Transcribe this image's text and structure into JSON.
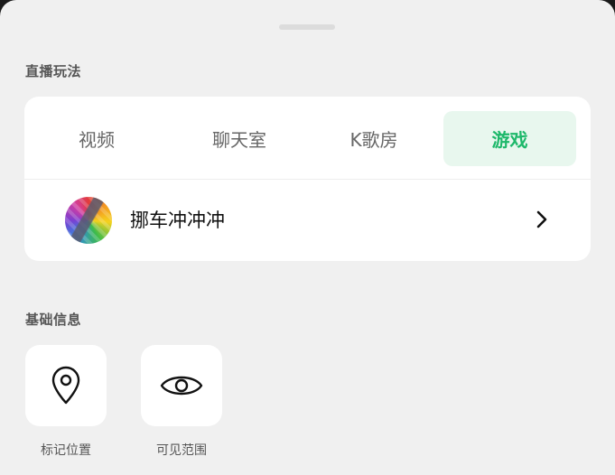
{
  "live_section": {
    "title": "直播玩法",
    "tabs": [
      {
        "label": "视频",
        "active": false
      },
      {
        "label": "聊天室",
        "active": false
      },
      {
        "label": "K歌房",
        "active": false
      },
      {
        "label": "游戏",
        "active": true
      }
    ],
    "game": {
      "name": "挪车冲冲冲",
      "avatar_icon": "game-cover-image",
      "chevron_icon": "chevron-right-icon"
    }
  },
  "basic_section": {
    "title": "基础信息",
    "items": [
      {
        "label": "标记位置",
        "icon": "location-pin-icon"
      },
      {
        "label": "可见范围",
        "icon": "eye-icon"
      }
    ]
  },
  "colors": {
    "accent": "#1db86a",
    "accent_bg": "#e8f7ee",
    "sheet_bg": "#f0f0f0",
    "card_bg": "#ffffff"
  }
}
